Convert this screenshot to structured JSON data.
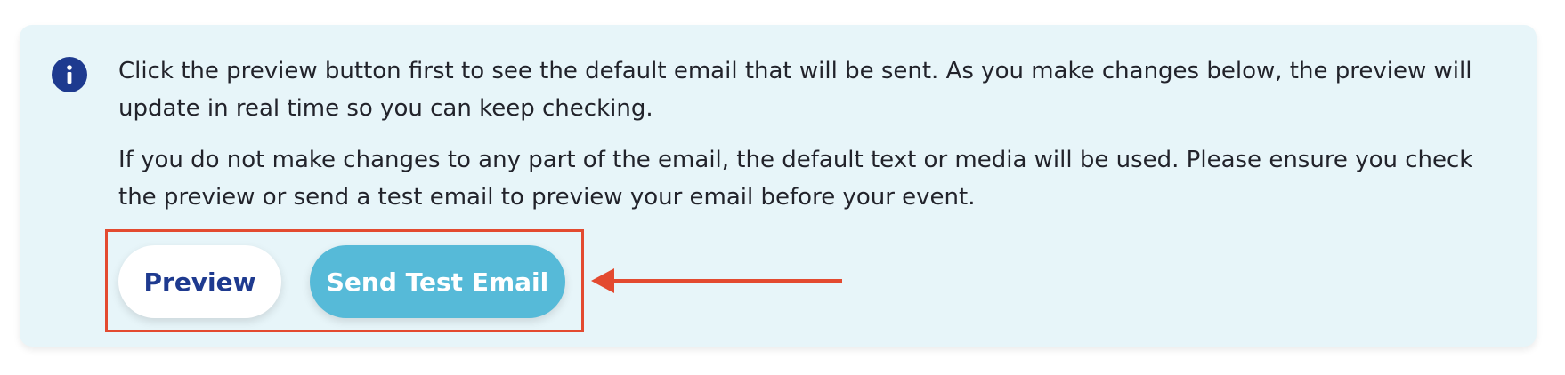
{
  "info_panel": {
    "icon": "info-icon",
    "paragraph_1": "Click the preview button first to see the default email that will be sent. As you make changes below, the preview will update in real time so you can keep checking.",
    "paragraph_2": "If you do not make changes to any part of the email, the default text or media will be used. Please ensure you check the preview or send a test email to preview your email before your event.",
    "preview_button_label": "Preview",
    "send_test_email_button_label": "Send Test Email"
  },
  "colors": {
    "panel_background": "#e7f5f9",
    "icon_background": "#1e3a8f",
    "preview_text": "#1e3a8f",
    "send_button_background": "#56bad8",
    "annotation": "#e34a30"
  },
  "annotation": {
    "highlight": "highlight-box",
    "arrow": "arrow-left-icon"
  }
}
